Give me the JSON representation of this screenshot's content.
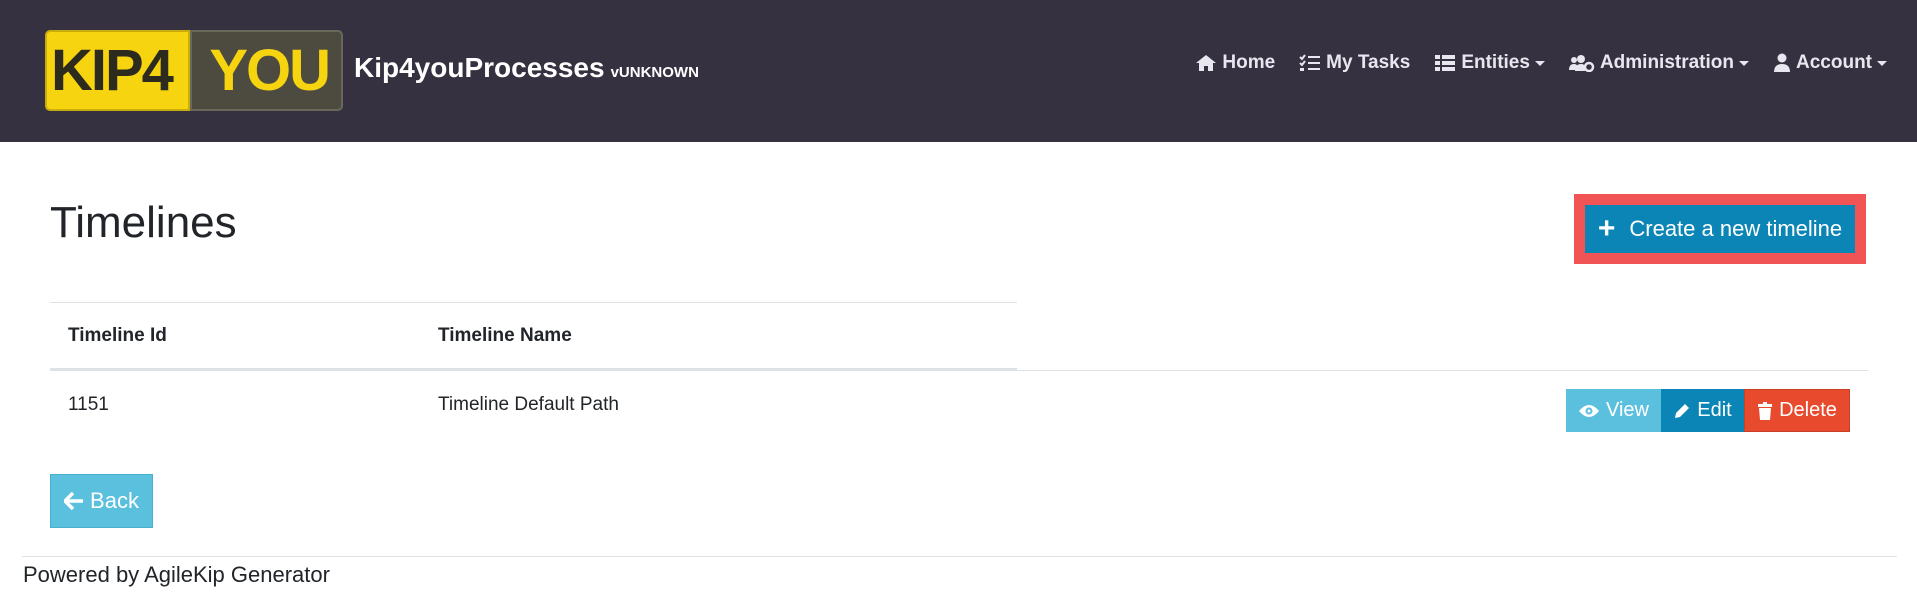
{
  "brand": {
    "logo_left_text": "KIP4",
    "logo_right_text": "YOU",
    "title": "Kip4youProcesses",
    "version": "vUNKNOWN"
  },
  "nav": {
    "home": "Home",
    "my_tasks": "My Tasks",
    "entities": "Entities",
    "administration": "Administration",
    "account": "Account"
  },
  "page": {
    "title": "Timelines",
    "create_button": "Create a new timeline",
    "back_button": "Back"
  },
  "table": {
    "headers": [
      "Timeline Id",
      "Timeline Name"
    ],
    "rows": [
      {
        "id": "1151",
        "name": "Timeline Default Path"
      }
    ],
    "actions": {
      "view": "View",
      "edit": "Edit",
      "delete": "Delete"
    }
  },
  "footer": {
    "text": "Powered by AgileKip Generator"
  },
  "colors": {
    "navbar_bg": "#353140",
    "logo_yellow": "#f6d40f",
    "primary": "#0b85b5",
    "info": "#5bc0de",
    "danger": "#e84a2d",
    "highlight": "#f05454"
  }
}
